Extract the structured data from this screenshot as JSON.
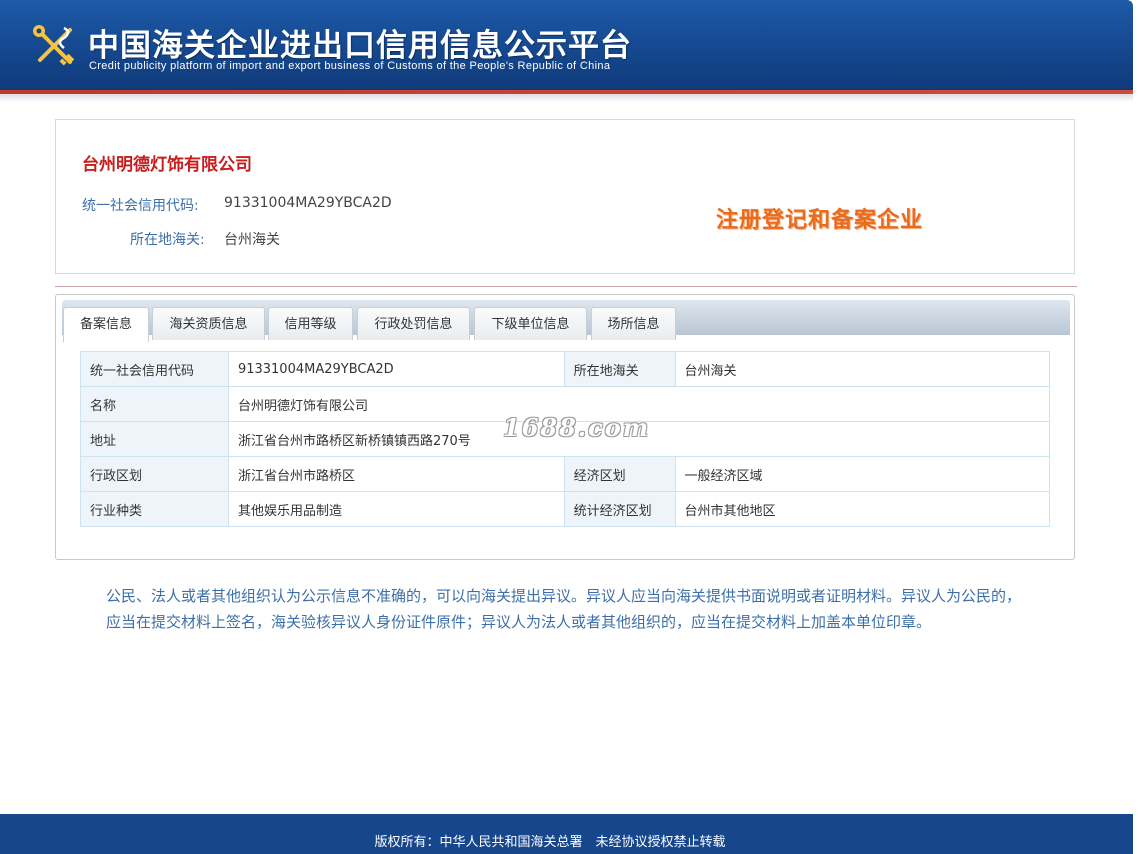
{
  "header": {
    "title_cn": "中国海关企业进出口信用信息公示平台",
    "title_en": "Credit publicity platform of import and export business of Customs of the People's Republic of China",
    "logo_icon": "customs-emblem-icon"
  },
  "company": {
    "name": "台州明德灯饰有限公司",
    "credit_code_label": "统一社会信用代码:",
    "credit_code": "91331004MA29YBCA2D",
    "customs_label": "所在地海关:",
    "customs": "台州海关",
    "status_stamp": "注册登记和备案企业"
  },
  "tabs": [
    {
      "label": "备案信息",
      "active": true
    },
    {
      "label": "海关资质信息",
      "active": false
    },
    {
      "label": "信用等级",
      "active": false
    },
    {
      "label": "行政处罚信息",
      "active": false
    },
    {
      "label": "下级单位信息",
      "active": false
    },
    {
      "label": "场所信息",
      "active": false
    }
  ],
  "table": {
    "rows": [
      {
        "l1": "统一社会信用代码",
        "v1": "91331004MA29YBCA2D",
        "l2": "所在地海关",
        "v2": "台州海关"
      },
      {
        "l1": "名称",
        "v1": "台州明德灯饰有限公司"
      },
      {
        "l1": "地址",
        "v1": "浙江省台州市路桥区新桥镇镇西路270号"
      },
      {
        "l1": "行政区划",
        "v1": "浙江省台州市路桥区",
        "l2": "经济区划",
        "v2": "一般经济区域"
      },
      {
        "l1": "行业种类",
        "v1": "其他娱乐用品制造",
        "l2": "统计经济区划",
        "v2": "台州市其他地区"
      }
    ]
  },
  "watermark": "1688.com",
  "notice": "公民、法人或者其他组织认为公示信息不准确的，可以向海关提出异议。异议人应当向海关提供书面说明或者证明材料。异议人为公民的，应当在提交材料上签名，海关验核异议人身份证件原件；异议人为法人或者其他组织的，应当在提交材料上加盖本单位印章。",
  "footer": {
    "copyright": "版权所有：中华人民共和国海关总署　未经协议授权禁止转载"
  },
  "colors": {
    "header_blue": "#15488f",
    "accent_red": "#c81e1e",
    "label_blue": "#3e6fa8",
    "stamp_orange": "#ea6a1e"
  }
}
